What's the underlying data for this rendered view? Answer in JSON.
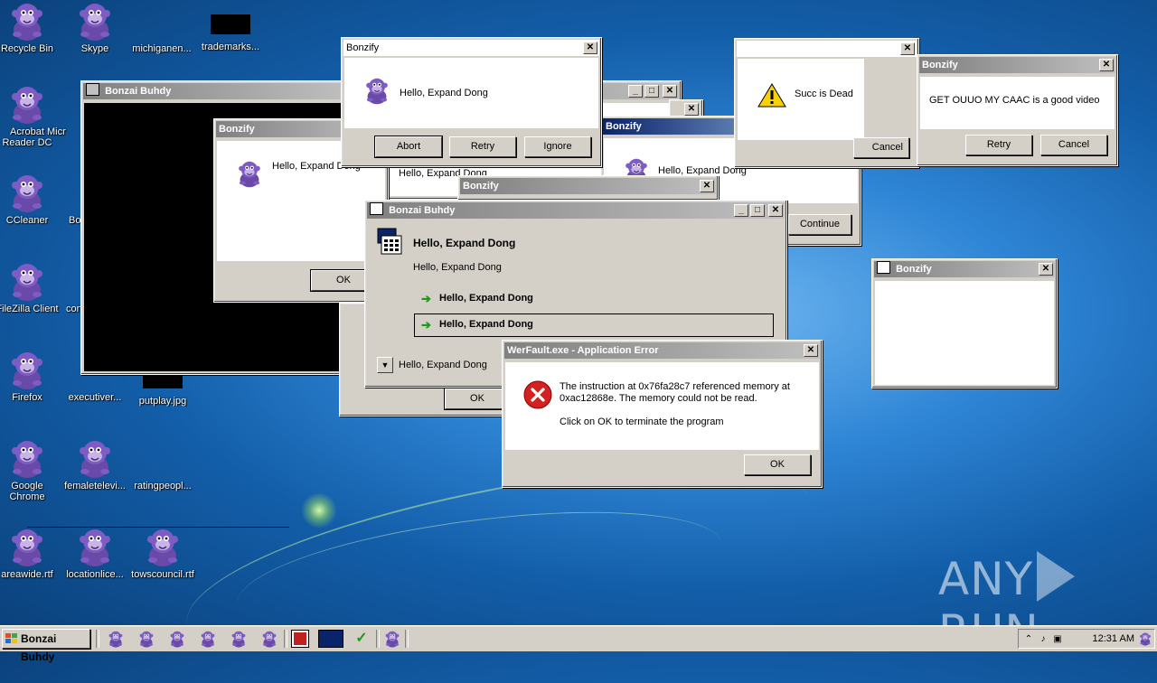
{
  "desktop": {
    "icons": [
      {
        "label": "Recycle Bin"
      },
      {
        "label": "Skype"
      },
      {
        "label": "michiganen..."
      },
      {
        "label": "trademarks..."
      },
      {
        "label": "Acrobat"
      },
      {
        "label": "Reader DC"
      },
      {
        "label": "Micr"
      },
      {
        "label": "CCleaner"
      },
      {
        "label": "Bo"
      },
      {
        "label": "FileZilla Client"
      },
      {
        "label": "con"
      },
      {
        "label": "Firefox"
      },
      {
        "label": "executiver..."
      },
      {
        "label": "putplay.jpg"
      },
      {
        "label": "Google"
      },
      {
        "label": "Chrome"
      },
      {
        "label": "femaletelevi..."
      },
      {
        "label": "ratingpeopl..."
      },
      {
        "label": "areawide.rtf"
      },
      {
        "label": "locationlice..."
      },
      {
        "label": "towscouncil.rtf"
      }
    ]
  },
  "windows": {
    "bonzai_back": {
      "title": "Bonzai Buhdy"
    },
    "bonzify_left": {
      "title": "Bonzify",
      "message": "Hello, Expand Dong",
      "ok": "OK"
    },
    "bonzify_top": {
      "title": "Bonzify",
      "message": "Hello, Expand Dong",
      "abort": "Abort",
      "retry": "Retry",
      "ignore": "Ignore"
    },
    "bonzify_mid": {
      "title": "Bonzify",
      "message": "Hello, Expand Dong",
      "continue": "Continue"
    },
    "bonzify_behind": {
      "message": "Hello, Expand Dong"
    },
    "bonzify_strip": {
      "title": "Bonzify"
    },
    "succ": {
      "message": "Succ is Dead",
      "cancel": "Cancel"
    },
    "caac": {
      "title": "Bonzify",
      "message": "GET OUUO MY CAAC is a good video",
      "retry": "Retry",
      "cancel": "Cancel"
    },
    "bonzify_blank": {
      "title": "Bonzify"
    },
    "bonzai_main": {
      "title": "Bonzai Buhdy",
      "heading": "Hello, Expand Dong",
      "subtext": "Hello, Expand Dong",
      "option1": "Hello, Expand Dong",
      "option2": "Hello, Expand Dong",
      "details": "Hello, Expand Dong",
      "ok": "OK"
    },
    "werfault": {
      "title": "WerFault.exe - Application Error",
      "line1": "The instruction at 0x76fa28c7 referenced memory at",
      "line2": "0xac12868e. The memory could not be read.",
      "line3": "Click on OK to terminate the program",
      "ok": "OK"
    }
  },
  "taskbar": {
    "start_label": "Bonzai Buhdy",
    "clock": "12:31 AM"
  },
  "watermark": {
    "left": "ANY",
    "right": "RUN"
  },
  "colors": {
    "title_active": "#0a246a",
    "title_inactive": "#808080",
    "face": "#d4d0c8",
    "desktop_bg": "#1f6ec0"
  }
}
